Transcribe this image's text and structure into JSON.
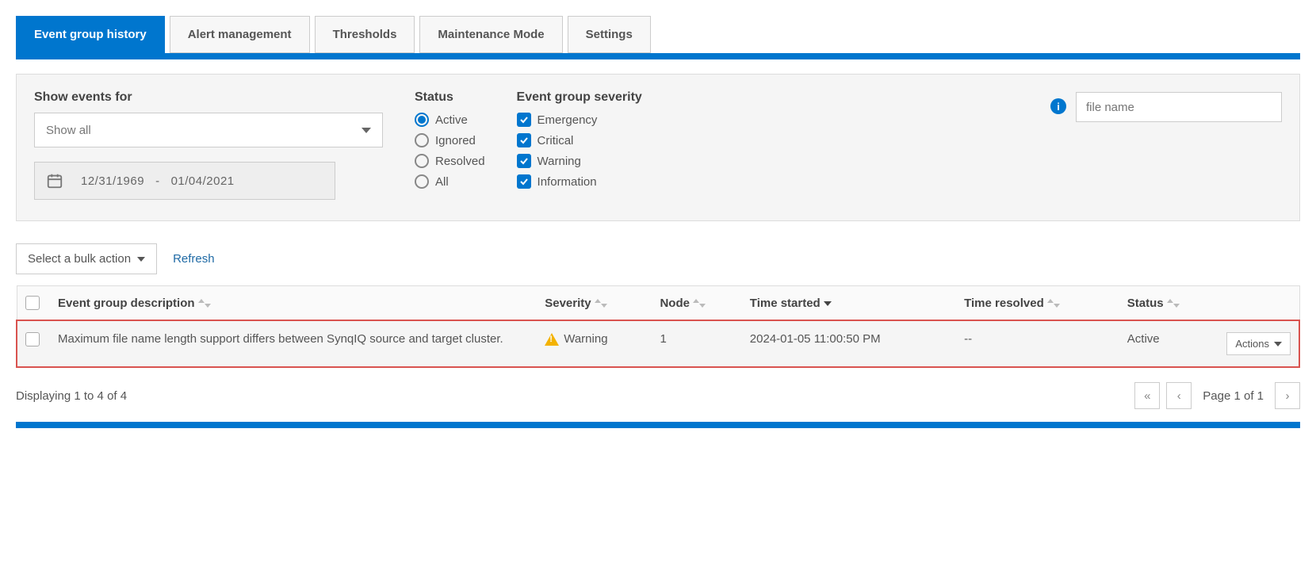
{
  "tabs": [
    {
      "label": "Event group history"
    },
    {
      "label": "Alert management"
    },
    {
      "label": "Thresholds"
    },
    {
      "label": "Maintenance Mode"
    },
    {
      "label": "Settings"
    }
  ],
  "filters": {
    "show_events_label": "Show events for",
    "show_events_value": "Show all",
    "date_from": "12/31/1969",
    "date_sep": "-",
    "date_to": "01/04/2021",
    "status_label": "Status",
    "status_options": {
      "active": "Active",
      "ignored": "Ignored",
      "resolved": "Resolved",
      "all": "All"
    },
    "severity_label": "Event group severity",
    "severity_options": {
      "emergency": "Emergency",
      "critical": "Critical",
      "warning": "Warning",
      "information": "Information"
    },
    "search_placeholder": "file name"
  },
  "toolbar": {
    "bulk_label": "Select a bulk action",
    "refresh_label": "Refresh"
  },
  "table": {
    "headers": {
      "description": "Event group description",
      "severity": "Severity",
      "node": "Node",
      "time_started": "Time started",
      "time_resolved": "Time resolved",
      "status": "Status"
    },
    "row": {
      "description": "Maximum file name length support differs between SynqIQ source and target cluster.",
      "severity": "Warning",
      "node": "1",
      "time_started": "2024-01-05 11:00:50 PM",
      "time_resolved": "--",
      "status": "Active",
      "actions": "Actions"
    }
  },
  "footer": {
    "display_text": "Displaying 1 to 4 of 4",
    "page_label": "Page 1 of 1"
  }
}
